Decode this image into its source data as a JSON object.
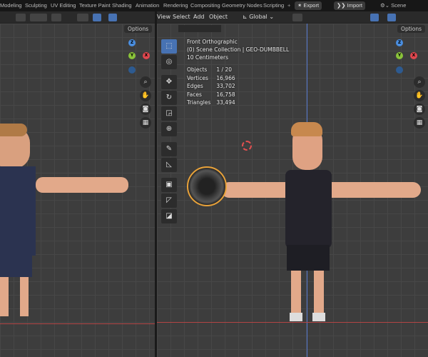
{
  "topbar": {
    "workspaces": [
      "Modeling",
      "Sculpting",
      "UV Editing",
      "Texture Paint",
      "Shading",
      "Animation",
      "Rendering",
      "Compositing",
      "Geometry Nodes",
      "Scripting",
      "+"
    ],
    "export": "Export",
    "import": "Import",
    "scene": "Scene"
  },
  "header": {
    "menu": [
      "View",
      "Select",
      "Add",
      "Object"
    ],
    "orientation": "Global"
  },
  "left_viewport": {
    "options": "Options"
  },
  "right_viewport": {
    "options": "Options",
    "overlay": {
      "view": "Front Orthographic",
      "collection": "(0) Scene Collection | GEO-DUMBBELL",
      "scale": "10 Centimeters"
    },
    "stats": [
      {
        "label": "Objects",
        "value": "1 / 20"
      },
      {
        "label": "Vertices",
        "value": "16,966"
      },
      {
        "label": "Edges",
        "value": "33,702"
      },
      {
        "label": "Faces",
        "value": "16,758"
      },
      {
        "label": "Triangles",
        "value": "33,494"
      }
    ]
  },
  "gizmo": {
    "x": "X",
    "y": "Y",
    "z": "Z"
  },
  "colors": {
    "accent": "#4772b3",
    "x_axis": "#e0474e",
    "y_axis": "#8ac33a",
    "z_axis": "#4a8ee0"
  }
}
